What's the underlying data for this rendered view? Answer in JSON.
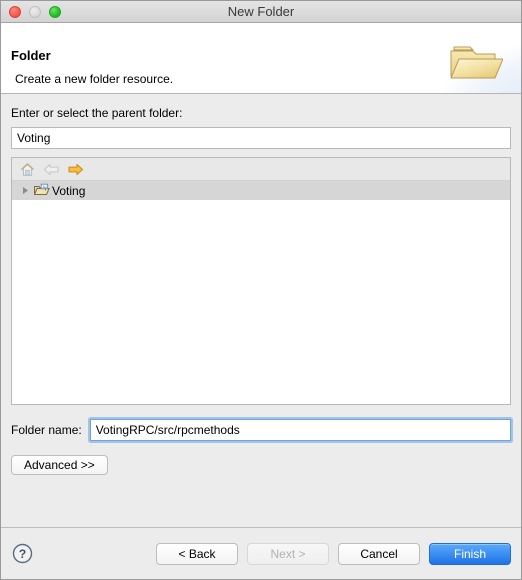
{
  "window": {
    "title": "New Folder",
    "controls": {
      "close": "close-button",
      "minimize": "minimize-button",
      "zoom": "zoom-button"
    }
  },
  "banner": {
    "title": "Folder",
    "subtitle": "Create a new folder resource.",
    "icon": "open-folder-icon"
  },
  "parent_folder": {
    "label": "Enter or select the parent folder:",
    "value": "Voting",
    "placeholder": ""
  },
  "tree": {
    "toolbar": [
      {
        "name": "home-icon",
        "label": "Home",
        "enabled": false
      },
      {
        "name": "back-arrow-icon",
        "label": "Back",
        "enabled": false
      },
      {
        "name": "forward-arrow-icon",
        "label": "Forward",
        "enabled": true
      }
    ],
    "rows": [
      {
        "label": "Voting",
        "icon": "project-folder-icon",
        "expander": "collapsed-triangle-icon",
        "selected": true
      }
    ]
  },
  "folder_name": {
    "label": "Folder name:",
    "value": "VotingRPC/src/rpcmethods",
    "placeholder": "",
    "focused": true
  },
  "advanced": {
    "label": "Advanced >>"
  },
  "footer": {
    "help": "help-icon",
    "buttons": [
      {
        "label": "< Back",
        "style": "normal",
        "enabled": true
      },
      {
        "label": "Next >",
        "style": "disabled",
        "enabled": false
      },
      {
        "label": "Cancel",
        "style": "normal",
        "enabled": true
      },
      {
        "label": "Finish",
        "style": "default",
        "enabled": true
      }
    ]
  },
  "colors": {
    "accent": "#1f72e6",
    "window_bg": "#ececec",
    "panel_bg": "#ffffff",
    "selection": "#d6d6d6",
    "folder_yellow": "#f0d98a"
  }
}
